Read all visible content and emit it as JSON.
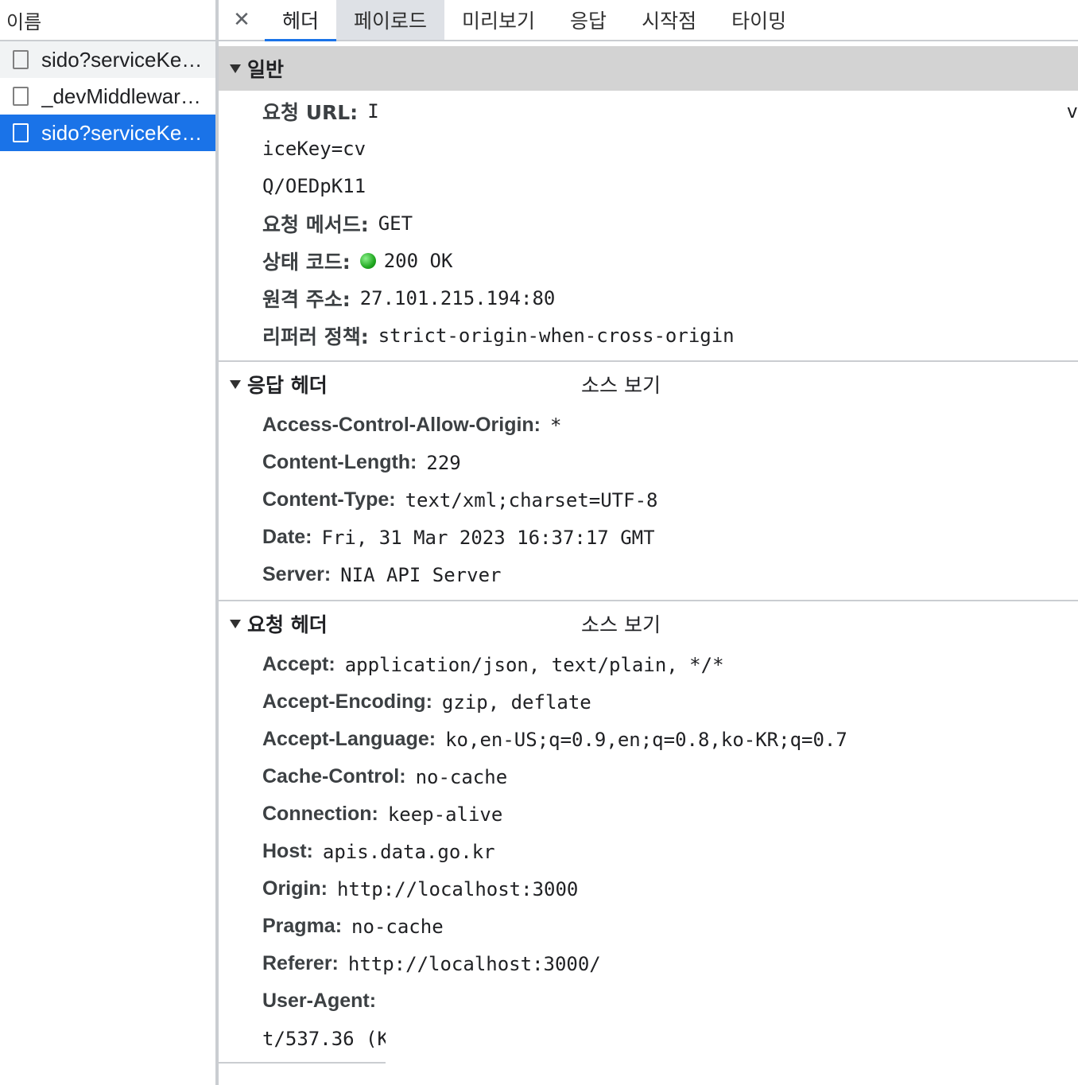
{
  "left": {
    "header": "이름",
    "requests": [
      {
        "name": "sido?serviceKe…"
      },
      {
        "name": "_devMiddlewar…"
      },
      {
        "name": "sido?serviceKe…"
      }
    ]
  },
  "tabs": {
    "close": "✕",
    "items": [
      "헤더",
      "페이로드",
      "미리보기",
      "응답",
      "시작점",
      "타이밍"
    ]
  },
  "general": {
    "title": "일반",
    "request_url_label": "요청 URL:",
    "request_url_value": "I",
    "request_url_tail": "v",
    "url_line2": "iceKey=cv",
    "url_line3": "Q/OEDpK11",
    "method_label": "요청 메서드:",
    "method_value": "GET",
    "status_label": "상태 코드:",
    "status_value": "200 OK",
    "remote_label": "원격 주소:",
    "remote_value": "27.101.215.194:80",
    "referrer_label": "리퍼러 정책:",
    "referrer_value": "strict-origin-when-cross-origin"
  },
  "response_headers": {
    "title": "응답 헤더",
    "view_source": "소스 보기",
    "items": [
      {
        "key": "Access-Control-Allow-Origin:",
        "value": "*"
      },
      {
        "key": "Content-Length:",
        "value": "229"
      },
      {
        "key": "Content-Type:",
        "value": "text/xml;charset=UTF-8"
      },
      {
        "key": "Date:",
        "value": "Fri, 31 Mar 2023 16:37:17 GMT"
      },
      {
        "key": "Server:",
        "value": "NIA API Server"
      }
    ]
  },
  "request_headers": {
    "title": "요청 헤더",
    "view_source": "소스 보기",
    "items": [
      {
        "key": "Accept:",
        "value": "application/json, text/plain, */*"
      },
      {
        "key": "Accept-Encoding:",
        "value": "gzip, deflate"
      },
      {
        "key": "Accept-Language:",
        "value": "ko,en-US;q=0.9,en;q=0.8,ko-KR;q=0.7"
      },
      {
        "key": "Cache-Control:",
        "value": "no-cache"
      },
      {
        "key": "Connection:",
        "value": "keep-alive"
      },
      {
        "key": "Host:",
        "value": "apis.data.go.kr"
      },
      {
        "key": "Origin:",
        "value": "http://localhost:3000"
      },
      {
        "key": "Pragma:",
        "value": "no-cache"
      },
      {
        "key": "Referer:",
        "value": "http://localhost:3000/"
      },
      {
        "key": "User-Agent:",
        "value": ""
      }
    ],
    "user_agent_line2": "t/537.36 (K"
  },
  "colors": {
    "accent": "#1a73e8",
    "status_ok": "#21a821",
    "section_bg": "#d3d3d3"
  }
}
